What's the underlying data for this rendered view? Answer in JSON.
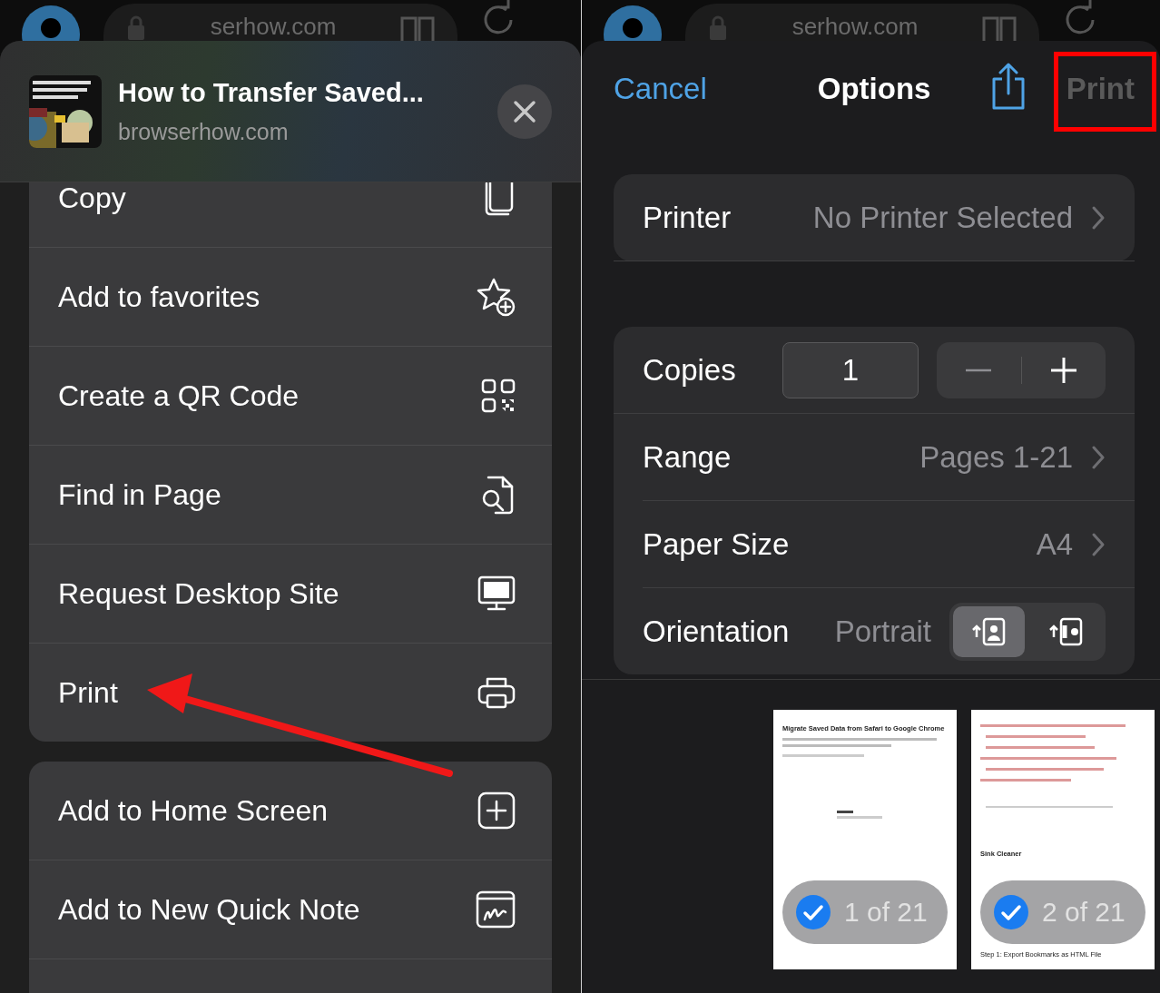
{
  "share_sheet": {
    "browser_bar": {
      "address": "serhow.com"
    },
    "header": {
      "title": "How to Transfer Saved...",
      "site": "browserhow.com"
    },
    "groups": [
      {
        "items": [
          {
            "label": "Copy"
          },
          {
            "label": "Add to favorites"
          },
          {
            "label": "Create a QR Code"
          },
          {
            "label": "Find in Page"
          },
          {
            "label": "Request Desktop Site"
          },
          {
            "label": "Print",
            "highlighted": true
          }
        ]
      },
      {
        "items": [
          {
            "label": "Add to Home Screen"
          },
          {
            "label": "Add to New Quick Note"
          }
        ]
      }
    ]
  },
  "print_options": {
    "browser_bar": {
      "address": "serhow.com"
    },
    "cancel": "Cancel",
    "title": "Options",
    "print_button": {
      "label": "Print",
      "disabled": true,
      "highlighted": true
    },
    "printer": {
      "label": "Printer",
      "value": "No Printer Selected"
    },
    "copies": {
      "label": "Copies",
      "value": "1"
    },
    "rows": [
      {
        "label": "Range",
        "value": "Pages 1-21"
      },
      {
        "label": "Paper Size",
        "value": "A4"
      }
    ],
    "orientation": {
      "label": "Orientation",
      "value": "Portrait",
      "options": [
        {
          "selected": true
        },
        {
          "selected": false
        }
      ]
    },
    "previews": [
      {
        "badge": "1 of 21",
        "selected": true,
        "texts": [
          "Migrate Saved Data from Safari to Google Chrome"
        ]
      },
      {
        "badge": "2 of 21",
        "selected": true,
        "texts": [
          "Sink Cleaner",
          "Step 1: Export Bookmarks as HTML File"
        ]
      }
    ]
  }
}
